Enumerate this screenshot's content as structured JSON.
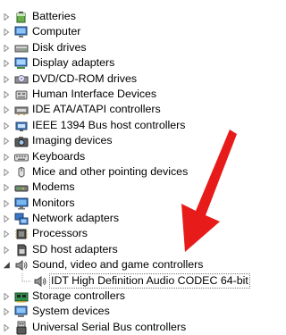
{
  "device_tree": {
    "items": [
      {
        "label": "Batteries",
        "icon": "battery-icon",
        "expanded": false
      },
      {
        "label": "Computer",
        "icon": "computer-icon",
        "expanded": false
      },
      {
        "label": "Disk drives",
        "icon": "disk-drive-icon",
        "expanded": false
      },
      {
        "label": "Display adapters",
        "icon": "display-adapter-icon",
        "expanded": false
      },
      {
        "label": "DVD/CD-ROM drives",
        "icon": "dvd-drive-icon",
        "expanded": false
      },
      {
        "label": "Human Interface Devices",
        "icon": "hid-icon",
        "expanded": false
      },
      {
        "label": "IDE ATA/ATAPI controllers",
        "icon": "ide-controller-icon",
        "expanded": false
      },
      {
        "label": "IEEE 1394 Bus host controllers",
        "icon": "firewire-icon",
        "expanded": false
      },
      {
        "label": "Imaging devices",
        "icon": "camera-icon",
        "expanded": false
      },
      {
        "label": "Keyboards",
        "icon": "keyboard-icon",
        "expanded": false
      },
      {
        "label": "Mice and other pointing devices",
        "icon": "mouse-icon",
        "expanded": false
      },
      {
        "label": "Modems",
        "icon": "modem-icon",
        "expanded": false
      },
      {
        "label": "Monitors",
        "icon": "monitor-icon",
        "expanded": false
      },
      {
        "label": "Network adapters",
        "icon": "network-adapter-icon",
        "expanded": false
      },
      {
        "label": "Processors",
        "icon": "processor-icon",
        "expanded": false
      },
      {
        "label": "SD host adapters",
        "icon": "sd-adapter-icon",
        "expanded": false
      },
      {
        "label": "Sound, video and game controllers",
        "icon": "speaker-icon",
        "expanded": true
      },
      {
        "label": "IDT High Definition Audio CODEC 64-bit",
        "icon": "audio-device-icon",
        "child": true
      },
      {
        "label": "Storage controllers",
        "icon": "storage-controller-icon",
        "expanded": false
      },
      {
        "label": "System devices",
        "icon": "system-device-icon",
        "expanded": false
      },
      {
        "label": "Universal Serial Bus controllers",
        "icon": "usb-icon",
        "expanded": false
      }
    ]
  },
  "colors": {
    "annotation_arrow": "#e81b1b",
    "tree_arrow": "#8c8c8c"
  }
}
